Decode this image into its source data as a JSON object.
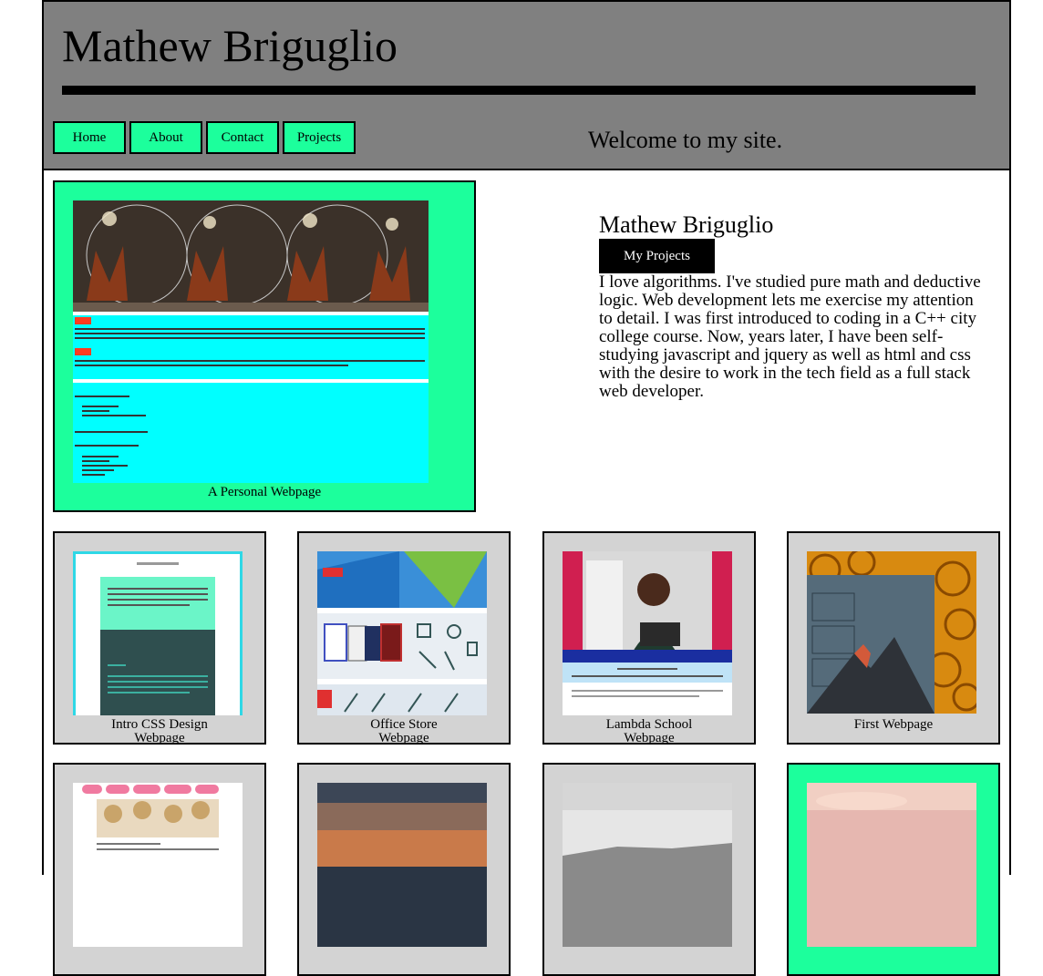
{
  "header": {
    "title": "Mathew Briguglio",
    "nav": [
      "Home",
      "About",
      "Contact",
      "Projects"
    ],
    "welcome": "Welcome to my site."
  },
  "featured": {
    "caption": "A Personal Webpage"
  },
  "intro": {
    "name": "Mathew Briguglio",
    "button": "My Projects",
    "text": "I love algorithms. I've studied pure math and deductive logic. Web development lets me exercise my attention to detail. I was first introduced to coding in a C++ city college course. Now, years later, I have been self-studying javascript and jquery as well as html and css with the desire to work in the tech field as a full stack web developer."
  },
  "projects": [
    {
      "caption_line1": "Intro CSS Design",
      "caption_line2": "Webpage"
    },
    {
      "caption_line1": "Office Store",
      "caption_line2": "Webpage"
    },
    {
      "caption_line1": "Lambda School",
      "caption_line2": "Webpage"
    },
    {
      "caption_line1": "First Webpage",
      "caption_line2": ""
    }
  ],
  "colors": {
    "header_bg": "#808080",
    "accent_green": "#1cff9c",
    "card_bg": "#d3d3d3",
    "cyan": "#00ffff"
  }
}
